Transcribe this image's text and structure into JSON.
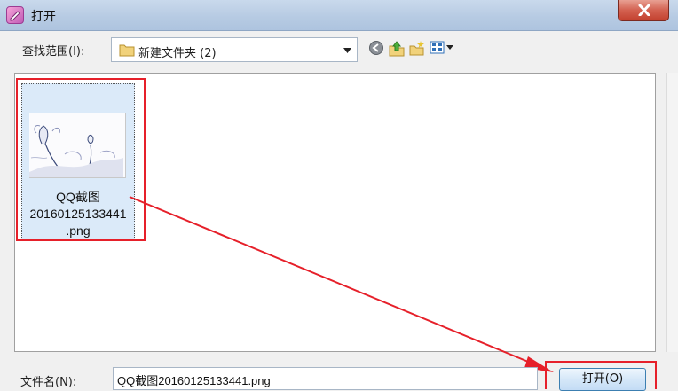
{
  "window": {
    "title": "打开",
    "close_icon": "close-icon",
    "app_icon": "app-icon"
  },
  "lookin": {
    "label": "查找范围(I):",
    "value": "新建文件夹 (2)",
    "folder_icon": "folder-icon"
  },
  "toolbar": {
    "icons": [
      "back-icon",
      "up-folder-icon",
      "new-folder-icon",
      "view-menu-icon"
    ]
  },
  "files": [
    {
      "name_line1": "QQ截图",
      "name_line2": "20160125133441",
      "name_line3": ".png",
      "selected": true
    }
  ],
  "bottom": {
    "filename_label": "文件名(N):",
    "filename_value": "QQ截图20160125133441.png",
    "open_button": "打开(O)"
  },
  "colors": {
    "annotation": "#e6202a",
    "selection": "#dbeaf9",
    "close_button": "#c3412f"
  }
}
